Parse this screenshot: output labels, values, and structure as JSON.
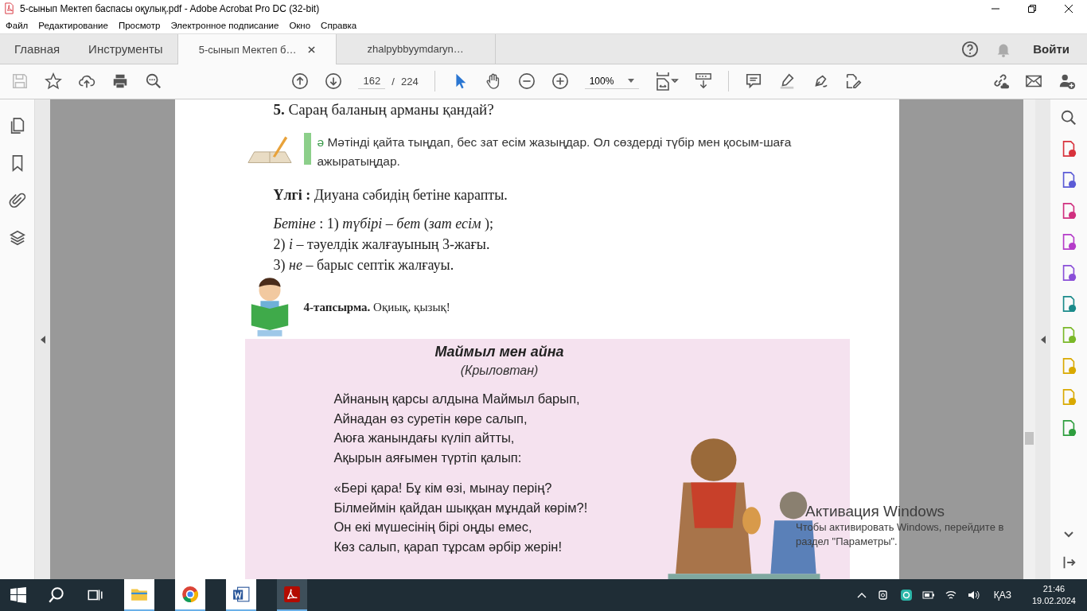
{
  "window": {
    "title": "5-сынып Мектеп баспасы оқулық.pdf - Adobe Acrobat Pro DC (32-bit)"
  },
  "menu": [
    "Файл",
    "Редактирование",
    "Просмотр",
    "Электронное подписание",
    "Окно",
    "Справка"
  ],
  "tabs": [
    {
      "label": "Главная",
      "kind": "nav",
      "selected": false
    },
    {
      "label": "Инструменты",
      "kind": "nav",
      "selected": false
    },
    {
      "label": "5-сынып Мектеп б…",
      "kind": "document",
      "selected": true
    },
    {
      "label": "zhalpybbyymdaryn…",
      "kind": "document",
      "selected": false
    }
  ],
  "sign_in": "Войти",
  "toolbar": {
    "save_disabled": true,
    "page_current": "162",
    "page_separator": "/",
    "page_total": "224",
    "zoom": "100%",
    "tools": [
      {
        "kind": "select",
        "selected": true
      },
      {
        "kind": "hand",
        "selected": false
      }
    ]
  },
  "document": {
    "question": "**5.** Сараң баланың арманы қандай?",
    "exercise": {
      "marker": "ә",
      "text": "Мәтінді қайта тыңдап, бес зат есім жазыңдар. Ол сөздерді түбір мен қосым-шаға ажыратыңдар."
    },
    "example": "**Үлгі :** Диуана сәбидің бетіне карапты.",
    "analysis": [
      "*Бетіне* : 1) *түбірі – бет* (*зат есім* );",
      "2) *і* – тәуелдік жалғауының 3-жағы.",
      "3) *не* – барыс септік жалғауы."
    ],
    "task": "**4-тапсырма.** Оқиық, қызық!",
    "poem": {
      "title": "Маймыл мен айна",
      "subtitle": "(Крыловтан)",
      "stanzas": [
        [
          "Айнаның қарсы алдына Маймыл барып,",
          "Айнадан өз суретін көре салып,",
          "Аюға жанындағы күліп айтты,",
          "Ақырын аяғымен түртіп қалып:"
        ],
        [
          "«Бері қара! Бұ кім өзі, мынау перің?",
          "Білмеймін қайдан шыққан мұндай көрім?!",
          "Он екі мүшесінің бірі оңды емес,",
          "Көз салып, қарап тұрсам әрбір жерін!"
        ]
      ]
    }
  },
  "activation": {
    "title": "Активация Windows",
    "lines": [
      "Чтобы активировать Windows, перейдите в",
      "раздел \"Параметры\"."
    ]
  },
  "taskbar": {
    "language": "ҚАЗ",
    "time": "21:46",
    "date": "19.02.2024"
  }
}
